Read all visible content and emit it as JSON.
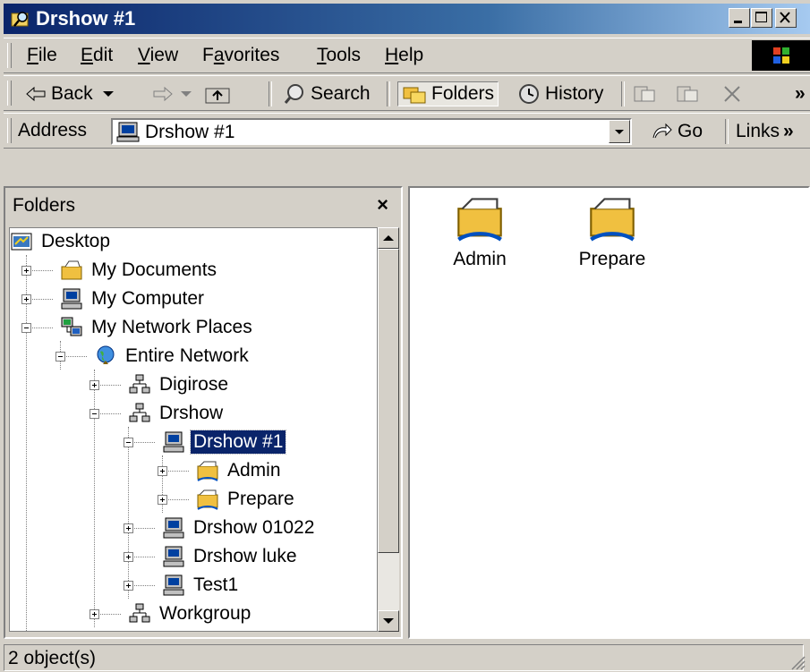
{
  "window": {
    "title": "Drshow #1"
  },
  "menu": {
    "file": "File",
    "edit": "Edit",
    "view": "View",
    "favorites": "Favorites",
    "tools": "Tools",
    "help": "Help"
  },
  "toolbar": {
    "back": "Back",
    "search": "Search",
    "folders": "Folders",
    "history": "History",
    "more": "»"
  },
  "address": {
    "label": "Address",
    "value": "Drshow #1",
    "go": "Go",
    "links": "Links",
    "links_more": "»"
  },
  "folders_pane": {
    "title": "Folders",
    "close": "×",
    "tree": [
      {
        "label": "Desktop",
        "icon": "desktop-icon"
      },
      {
        "label": "My Documents",
        "icon": "my-documents-icon"
      },
      {
        "label": "My Computer",
        "icon": "computer-icon"
      },
      {
        "label": "My Network Places",
        "icon": "network-places-icon"
      },
      {
        "label": "Entire Network",
        "icon": "globe-icon"
      },
      {
        "label": "Digirose",
        "icon": "workgroup-icon"
      },
      {
        "label": "Drshow",
        "icon": "workgroup-icon"
      },
      {
        "label": "Drshow #1",
        "icon": "computer-icon",
        "selected": true
      },
      {
        "label": "Admin",
        "icon": "shared-folder-icon"
      },
      {
        "label": "Prepare",
        "icon": "shared-folder-icon"
      },
      {
        "label": "Drshow 01022",
        "icon": "computer-icon"
      },
      {
        "label": "Drshow luke",
        "icon": "computer-icon"
      },
      {
        "label": "Test1",
        "icon": "computer-icon"
      },
      {
        "label": "Workgroup",
        "icon": "workgroup-icon"
      }
    ]
  },
  "content": {
    "items": [
      {
        "label": "Admin",
        "icon": "shared-folder-icon"
      },
      {
        "label": "Prepare",
        "icon": "shared-folder-icon"
      }
    ]
  },
  "status": {
    "text": "2 object(s)"
  }
}
